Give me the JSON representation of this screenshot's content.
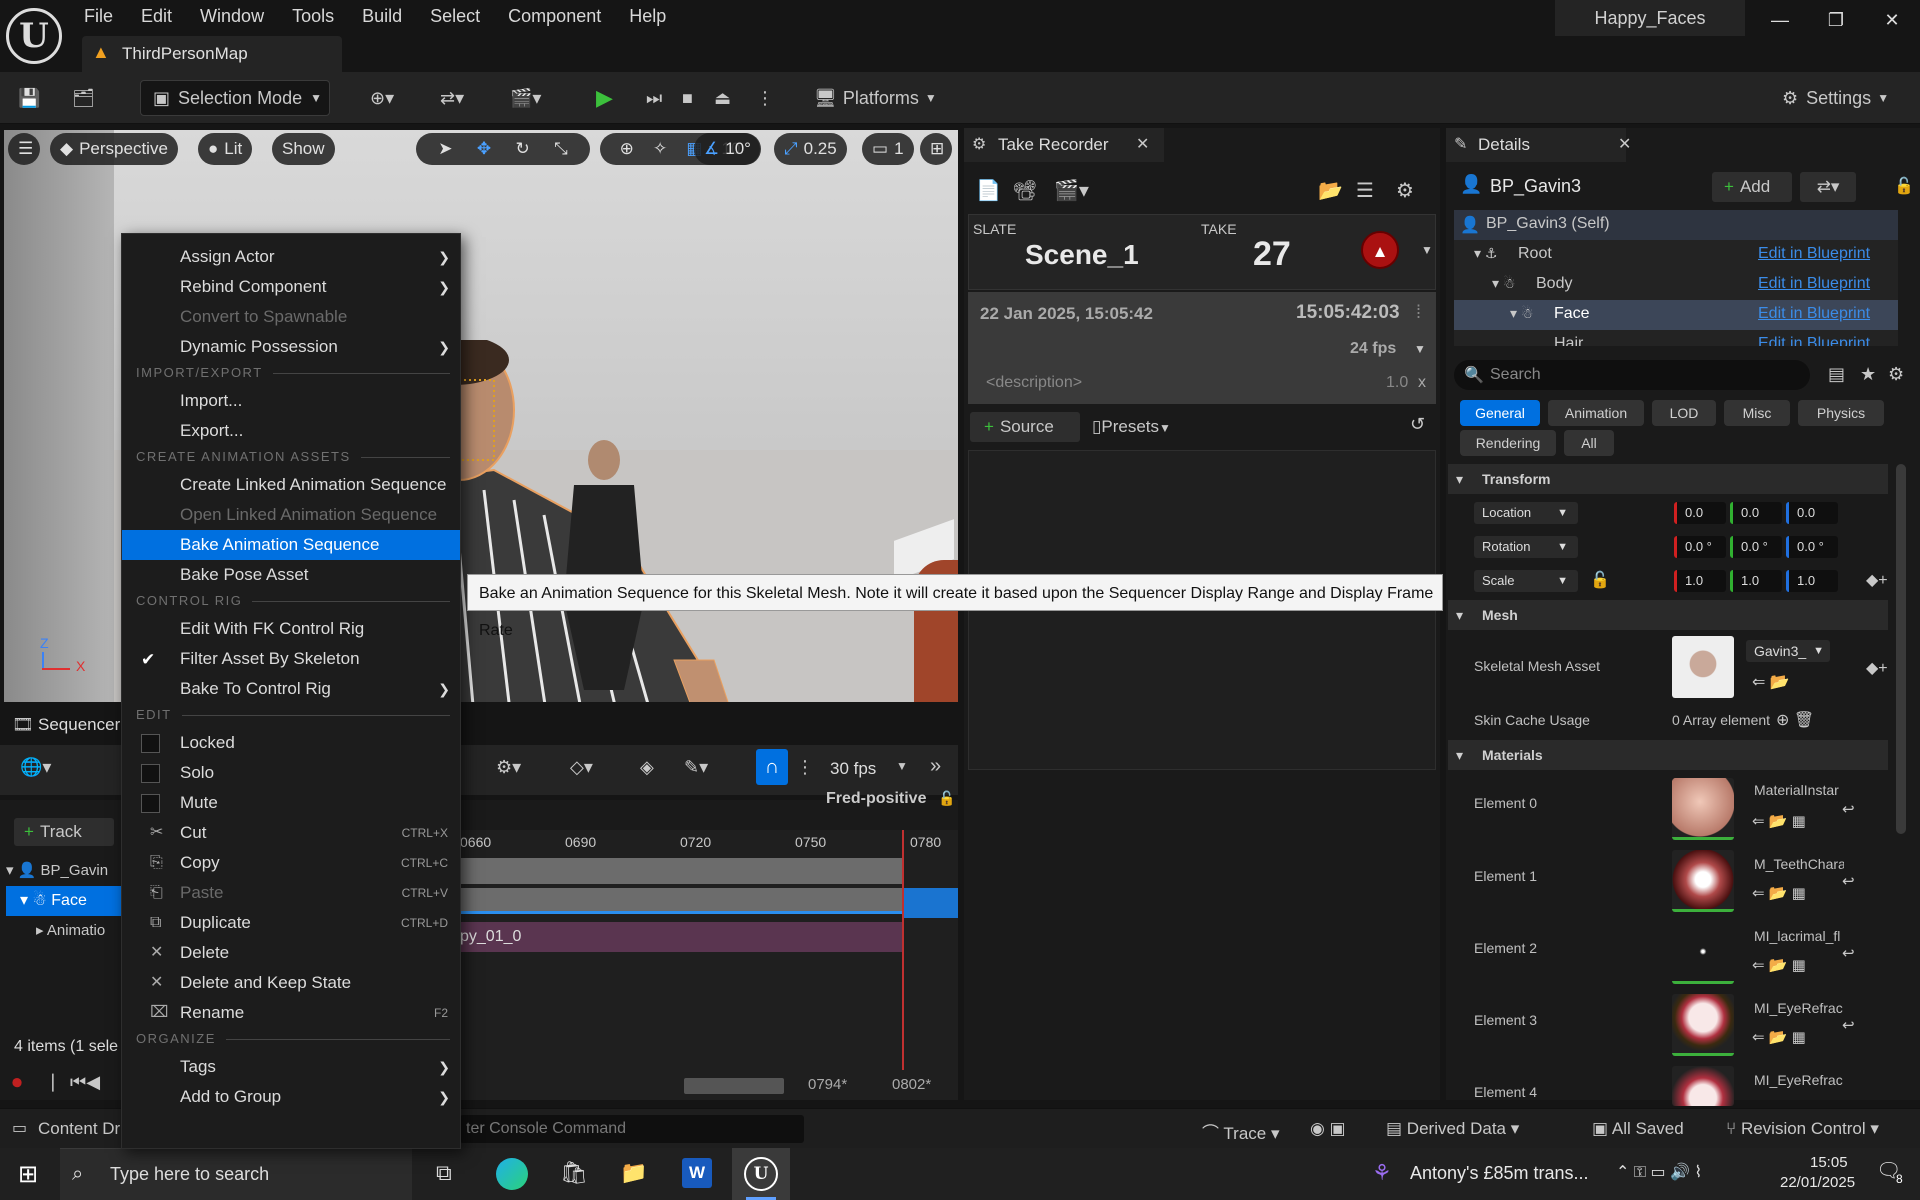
{
  "menubar": [
    "File",
    "Edit",
    "Window",
    "Tools",
    "Build",
    "Select",
    "Component",
    "Help"
  ],
  "project_name": "Happy_Faces",
  "map_tab": "ThirdPersonMap",
  "toolbar": {
    "selection_mode": "Selection Mode",
    "platforms": "Platforms",
    "settings": "Settings"
  },
  "viewport": {
    "perspective": "Perspective",
    "lit": "Lit",
    "show": "Show",
    "grid": "10",
    "angle": "10°",
    "scale": "0.25",
    "camera": "1",
    "axis_z": "Z",
    "axis_x": "X"
  },
  "sequencer": {
    "tab": "Sequencer",
    "fps": "30 fps",
    "track_btn": "Track",
    "user": "Fred-positive",
    "tracks": [
      "BP_Gavin",
      "Face",
      "Animatio"
    ],
    "ticks": [
      "0660",
      "0690",
      "0720",
      "0750",
      "0780"
    ],
    "clip_label": "py_01_0",
    "items_status": "4 items (1 sele",
    "frame_a": "0794*",
    "frame_b": "0802*"
  },
  "take_recorder": {
    "tab": "Take Recorder",
    "slate_label": "SLATE",
    "slate": "Scene_1",
    "take_label": "TAKE",
    "take": "27",
    "date": "22 Jan 2025, 15:05:42",
    "timecode": "15:05:42:03",
    "fps": "24 fps",
    "description": "<description>",
    "speed": "1.0",
    "speed_x": "x",
    "source_btn": "Source",
    "presets": "Presets"
  },
  "details": {
    "tab": "Details",
    "actor": "BP_Gavin3",
    "add": "Add",
    "tree": [
      {
        "label": "BP_Gavin3 (Self)",
        "link": ""
      },
      {
        "label": "Root",
        "link": "Edit in Blueprint"
      },
      {
        "label": "Body",
        "link": "Edit in Blueprint"
      },
      {
        "label": "Face",
        "link": "Edit in Blueprint"
      },
      {
        "label": "Hair",
        "link": "Edit in Blueprint"
      }
    ],
    "search_placeholder": "Search",
    "filters": [
      "General",
      "Animation",
      "LOD",
      "Misc",
      "Physics",
      "Rendering",
      "All"
    ],
    "transform": {
      "section": "Transform",
      "location": "Location",
      "rotation": "Rotation",
      "scale": "Scale",
      "loc_vals": [
        "0.0",
        "0.0",
        "0.0"
      ],
      "rot_vals": [
        "0.0 °",
        "0.0 °",
        "0.0 °"
      ],
      "scale_vals": [
        "1.0",
        "1.0",
        "1.0"
      ]
    },
    "mesh": {
      "section": "Mesh",
      "asset_label": "Skeletal Mesh Asset",
      "asset_value": "Gavin3_",
      "skin_label": "Skin Cache Usage",
      "skin_value": "0 Array element"
    },
    "materials": {
      "section": "Materials",
      "elements": [
        {
          "label": "Element 0",
          "value": "MaterialInstar"
        },
        {
          "label": "Element 1",
          "value": "M_TeethChara"
        },
        {
          "label": "Element 2",
          "value": "MI_lacrimal_fl"
        },
        {
          "label": "Element 3",
          "value": "MI_EyeRefrac"
        },
        {
          "label": "Element 4",
          "value": "MI_EyeRefrac"
        }
      ]
    }
  },
  "context_menu": {
    "items": [
      {
        "type": "item",
        "label": "Assign Actor",
        "arrow": true
      },
      {
        "type": "item",
        "label": "Rebind Component",
        "arrow": true
      },
      {
        "type": "item",
        "label": "Convert to Spawnable",
        "disabled": true
      },
      {
        "type": "item",
        "label": "Dynamic Possession",
        "arrow": true
      },
      {
        "type": "header",
        "label": "IMPORT/EXPORT"
      },
      {
        "type": "item",
        "label": "Import..."
      },
      {
        "type": "item",
        "label": "Export..."
      },
      {
        "type": "header",
        "label": "CREATE ANIMATION ASSETS"
      },
      {
        "type": "item",
        "label": "Create Linked Animation Sequence"
      },
      {
        "type": "item",
        "label": "Open Linked Animation Sequence",
        "disabled": true
      },
      {
        "type": "item",
        "label": "Bake Animation Sequence",
        "selected": true
      },
      {
        "type": "item",
        "label": "Bake Pose Asset"
      },
      {
        "type": "header",
        "label": "CONTROL RIG"
      },
      {
        "type": "item",
        "label": "Edit With FK Control Rig"
      },
      {
        "type": "item",
        "label": "Filter Asset By Skeleton",
        "check": "checked"
      },
      {
        "type": "item",
        "label": "Bake To Control Rig",
        "arrow": true
      },
      {
        "type": "header",
        "label": "EDIT"
      },
      {
        "type": "item",
        "label": "Locked",
        "check": "box"
      },
      {
        "type": "item",
        "label": "Solo",
        "check": "box"
      },
      {
        "type": "item",
        "label": "Mute",
        "check": "box"
      },
      {
        "type": "item",
        "label": "Cut",
        "shortcut": "CTRL+X",
        "icon": "cut"
      },
      {
        "type": "item",
        "label": "Copy",
        "shortcut": "CTRL+C",
        "icon": "copy"
      },
      {
        "type": "item",
        "label": "Paste",
        "shortcut": "CTRL+V",
        "icon": "paste",
        "disabled": true
      },
      {
        "type": "item",
        "label": "Duplicate",
        "shortcut": "CTRL+D",
        "icon": "dup"
      },
      {
        "type": "item",
        "label": "Delete",
        "icon": "x"
      },
      {
        "type": "item",
        "label": "Delete and Keep State",
        "icon": "x"
      },
      {
        "type": "item",
        "label": "Rename",
        "shortcut": "F2",
        "icon": "rename"
      },
      {
        "type": "header",
        "label": "ORGANIZE"
      },
      {
        "type": "item",
        "label": "Tags",
        "arrow": true
      },
      {
        "type": "item",
        "label": "Add to Group",
        "arrow": true
      }
    ]
  },
  "tooltip": "Bake an Animation Sequence for this Skeletal Mesh. Note it will create it based upon the Sequencer Display Range and Display Frame Rate",
  "statusbar": {
    "content_drawer": "Content Dr",
    "console": "ter Console Command",
    "trace": "Trace",
    "derived": "Derived Data",
    "saved": "All Saved",
    "revision": "Revision Control"
  },
  "taskbar": {
    "search": "Type here to search",
    "news": "Antony's £85m trans...",
    "time": "15:05",
    "date": "22/01/2025",
    "notif": "8"
  }
}
